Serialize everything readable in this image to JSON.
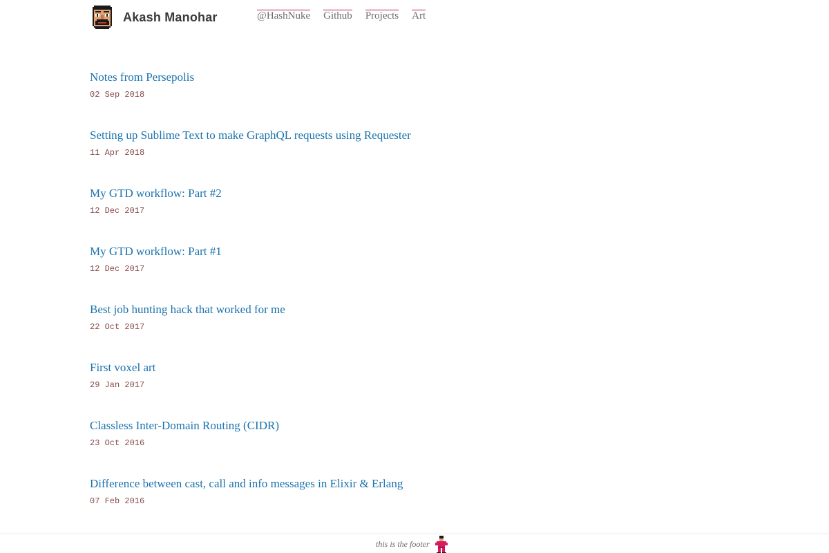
{
  "header": {
    "site_title": "Akash Manohar",
    "avatar_icon": "pixel-face-avatar-icon",
    "nav": [
      {
        "label": "@HashNuke"
      },
      {
        "label": "Github"
      },
      {
        "label": "Projects"
      },
      {
        "label": "Art"
      }
    ],
    "nav_accent_color": "#c2185b"
  },
  "posts": [
    {
      "title": "Notes from Persepolis",
      "date": "02 Sep 2018"
    },
    {
      "title": "Setting up Sublime Text to make GraphQL requests using Requester",
      "date": "11 Apr 2018"
    },
    {
      "title": "My GTD workflow: Part #2",
      "date": "12 Dec 2017"
    },
    {
      "title": "My GTD workflow: Part #1",
      "date": "12 Dec 2017"
    },
    {
      "title": "Best job hunting hack that worked for me",
      "date": "22 Oct 2017"
    },
    {
      "title": "First voxel art",
      "date": "29 Jan 2017"
    },
    {
      "title": "Classless Inter-Domain Routing (CIDR)",
      "date": "23 Oct 2016"
    },
    {
      "title": "Difference between cast, call and info messages in Elixir & Erlang",
      "date": "07 Feb 2016"
    }
  ],
  "footer": {
    "text": "this is the footer",
    "mascot_icon": "pixel-character-icon"
  },
  "colors": {
    "link": "#1a73ad",
    "date": "#8a4a4a",
    "title": "#3a3a3a"
  }
}
